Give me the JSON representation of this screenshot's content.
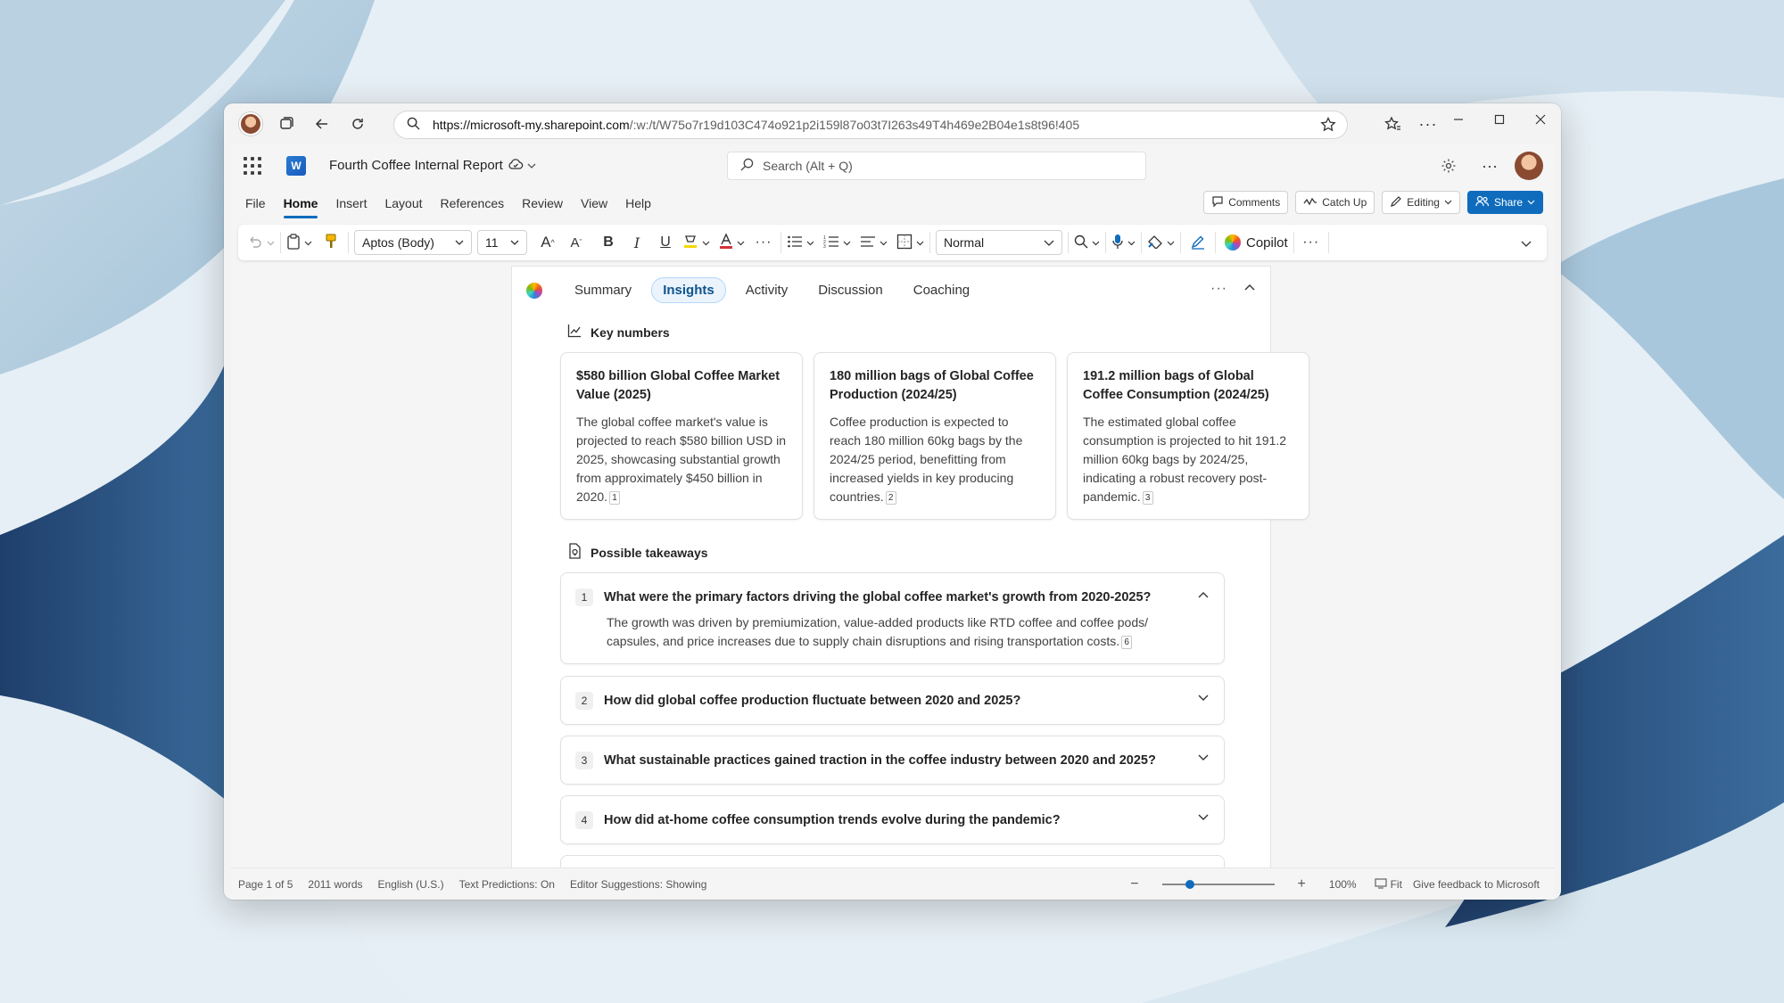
{
  "browser": {
    "url_host": "https://microsoft-my.sharepoint.com",
    "url_path": "/:w:/t/W75o7r19d103C474o921p2i159l87o03t7I263s49T4h469e2B04e1s8t96!405"
  },
  "app": {
    "doc_title": "Fourth Coffee Internal Report",
    "search_placeholder": "Search (Alt + Q)"
  },
  "menubar": {
    "items": [
      "File",
      "Home",
      "Insert",
      "Layout",
      "References",
      "Review",
      "View",
      "Help"
    ],
    "active": "Home",
    "comments_label": "Comments",
    "catchup_label": "Catch Up",
    "editing_label": "Editing",
    "share_label": "Share"
  },
  "ribbon": {
    "font_name": "Aptos (Body)",
    "font_size": "11",
    "style_name": "Normal",
    "copilot_label": "Copilot"
  },
  "copilot": {
    "tabs": [
      "Summary",
      "Insights",
      "Activity",
      "Discussion",
      "Coaching"
    ],
    "active_tab": "Insights",
    "key_numbers_heading": "Key numbers",
    "key_numbers": [
      {
        "title": "$580 billion Global Coffee Market Value (2025)",
        "body": "The global coffee market's value is projected to reach $580 billion USD in 2025, showcasing substantial growth from approximately $450 billion in 2020.",
        "cite": "1"
      },
      {
        "title": "180 million bags of Global Coffee Production (2024/25)",
        "body": "Coffee production is expected to reach 180 million 60kg bags by the 2024/25 period, benefitting from increased yields in key producing countries.",
        "cite": "2"
      },
      {
        "title": "191.2 million bags of Global Coffee Consumption (2024/25)",
        "body": "The estimated global coffee consumption is projected to hit 191.2 million 60kg bags by 2024/25, indicating a robust recovery post-pandemic.",
        "cite": "3"
      }
    ],
    "takeaways_heading": "Possible takeaways",
    "takeaways": [
      {
        "num": "1",
        "question": "What were the primary factors driving the global coffee market's growth from 2020-2025?",
        "answer": "The growth was driven by premiumization, value-added products like RTD coffee and coffee pods/ capsules, and price increases due to supply chain disruptions and rising transportation costs.",
        "cite": "6"
      },
      {
        "num": "2",
        "question": "How did global coffee production fluctuate between 2020 and 2025?"
      },
      {
        "num": "3",
        "question": "What sustainable practices gained traction in the coffee industry between 2020 and 2025?"
      },
      {
        "num": "4",
        "question": "How did at-home coffee consumption trends evolve during the pandemic?"
      }
    ]
  },
  "statusbar": {
    "page": "Page 1 of 5",
    "words": "2011 words",
    "language": "English (U.S.)",
    "text_predictions": "Text Predictions: On",
    "editor_suggestions": "Editor Suggestions: Showing",
    "zoom": "100%",
    "zoom_level": 0.25,
    "fit": "Fit",
    "feedback": "Give feedback to Microsoft"
  },
  "colors": {
    "accent": "#0f6cbd",
    "active_tab_bg": "#ebf3fc"
  }
}
